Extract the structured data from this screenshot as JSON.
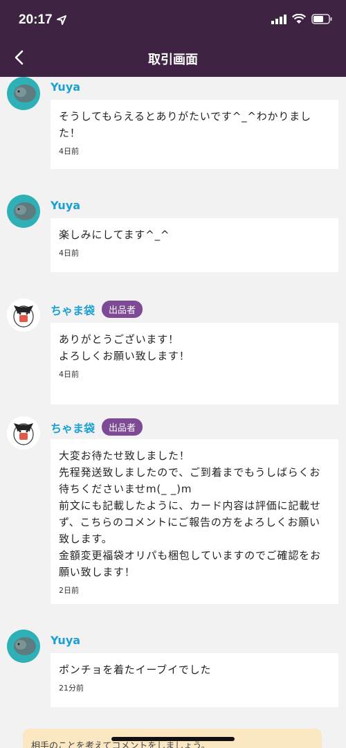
{
  "status_bar": {
    "time": "20:17"
  },
  "nav": {
    "title": "取引画面"
  },
  "colors": {
    "header_bg": "#3e2442",
    "name_blue": "#1aa0d2",
    "badge_purple": "#7d4a96"
  },
  "messages": [
    {
      "sender": "Yuya",
      "text": "そうしてもらえるとありがたいです^_^わかりました！",
      "time": "4日前"
    },
    {
      "sender": "Yuya",
      "text": "楽しみにしてます^_^",
      "time": "4日前"
    },
    {
      "sender": "ちゃま袋",
      "badge": "出品者",
      "text": "ありがとうございます！\nよろしくお願い致します！",
      "time": "4日前"
    },
    {
      "sender": "ちゃま袋",
      "badge": "出品者",
      "text": "大変お待たせ致しました！\n先程発送致しましたので、ご到着までもうしばらくお待ちくださいませm(_ _)m\n前文にも記載したように、カード内容は評価に記載せず、こちらのコメントにご報告の方をよろしくお願い致します。\n金額変更福袋オリパも梱包していますのでご確認をお願い致します！",
      "time": "2日前"
    },
    {
      "sender": "Yuya",
      "text": "ポンチョを着たイーブイでした",
      "time": "21分前"
    }
  ],
  "notice": {
    "text": "相手のことを考えてコメントをしましょう。"
  }
}
